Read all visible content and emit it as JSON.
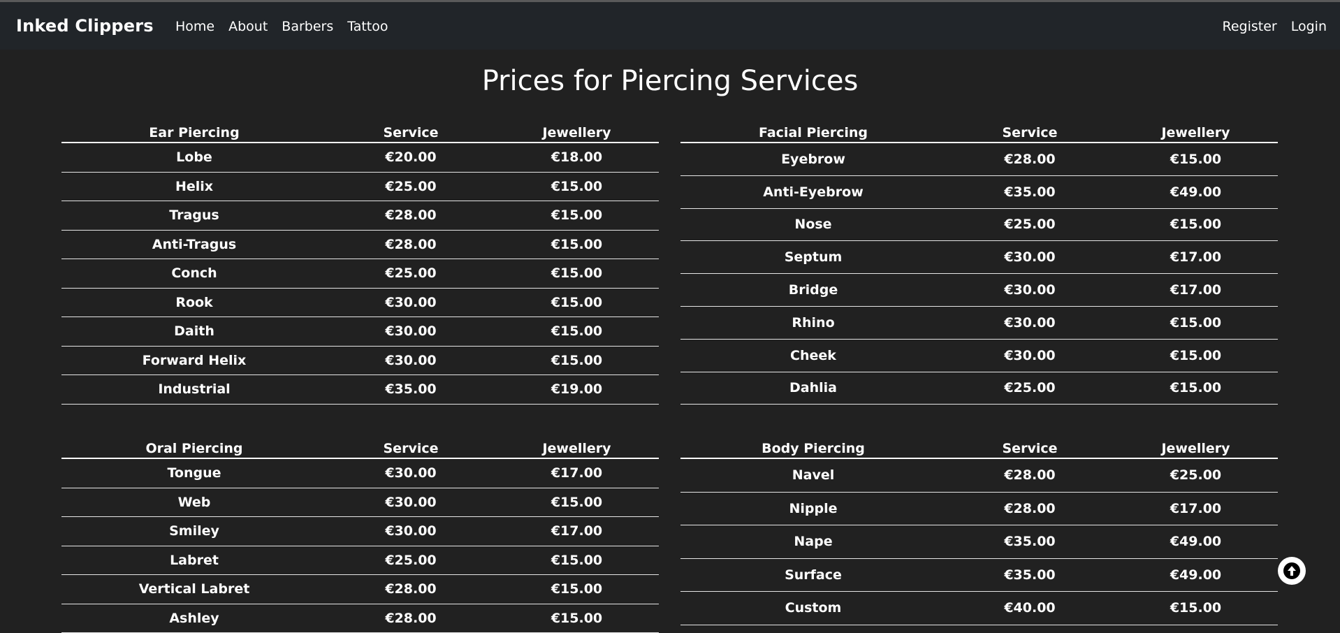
{
  "nav": {
    "brand": "Inked Clippers",
    "links": [
      "Home",
      "About",
      "Barbers",
      "Tattoo"
    ],
    "auth": [
      "Register",
      "Login"
    ]
  },
  "page": {
    "title": "Prices for Piercing Services"
  },
  "tables": {
    "ear": {
      "headers": [
        "Ear Piercing",
        "Service",
        "Jewellery"
      ],
      "rows": [
        [
          "Lobe",
          "€20.00",
          "€18.00"
        ],
        [
          "Helix",
          "€25.00",
          "€15.00"
        ],
        [
          "Tragus",
          "€28.00",
          "€15.00"
        ],
        [
          "Anti-Tragus",
          "€28.00",
          "€15.00"
        ],
        [
          "Conch",
          "€25.00",
          "€15.00"
        ],
        [
          "Rook",
          "€30.00",
          "€15.00"
        ],
        [
          "Daith",
          "€30.00",
          "€15.00"
        ],
        [
          "Forward Helix",
          "€30.00",
          "€15.00"
        ],
        [
          "Industrial",
          "€35.00",
          "€19.00"
        ]
      ]
    },
    "facial": {
      "headers": [
        "Facial Piercing",
        "Service",
        "Jewellery"
      ],
      "rows": [
        [
          "Eyebrow",
          "€28.00",
          "€15.00"
        ],
        [
          "Anti-Eyebrow",
          "€35.00",
          "€49.00"
        ],
        [
          "Nose",
          "€25.00",
          "€15.00"
        ],
        [
          "Septum",
          "€30.00",
          "€17.00"
        ],
        [
          "Bridge",
          "€30.00",
          "€17.00"
        ],
        [
          "Rhino",
          "€30.00",
          "€15.00"
        ],
        [
          "Cheek",
          "€30.00",
          "€15.00"
        ],
        [
          "Dahlia",
          "€25.00",
          "€15.00"
        ]
      ]
    },
    "oral": {
      "headers": [
        "Oral Piercing",
        "Service",
        "Jewellery"
      ],
      "rows": [
        [
          "Tongue",
          "€30.00",
          "€17.00"
        ],
        [
          "Web",
          "€30.00",
          "€15.00"
        ],
        [
          "Smiley",
          "€30.00",
          "€17.00"
        ],
        [
          "Labret",
          "€25.00",
          "€15.00"
        ],
        [
          "Vertical Labret",
          "€28.00",
          "€15.00"
        ],
        [
          "Ashley",
          "€28.00",
          "€15.00"
        ]
      ]
    },
    "body": {
      "headers": [
        "Body Piercing",
        "Service",
        "Jewellery"
      ],
      "rows": [
        [
          "Navel",
          "€28.00",
          "€25.00"
        ],
        [
          "Nipple",
          "€28.00",
          "€17.00"
        ],
        [
          "Nape",
          "€35.00",
          "€49.00"
        ],
        [
          "Surface",
          "€35.00",
          "€49.00"
        ],
        [
          "Custom",
          "€40.00",
          "€15.00"
        ]
      ]
    }
  },
  "scroll_top": {
    "icon": "arrow-up-circle-icon"
  }
}
